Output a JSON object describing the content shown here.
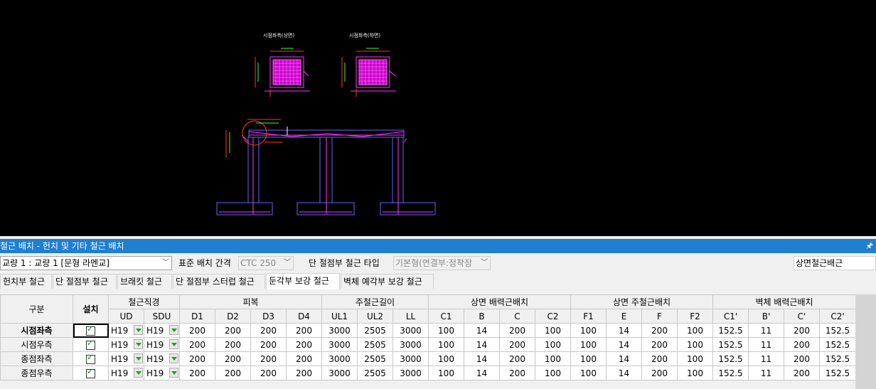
{
  "drawing": {
    "title_left": "시점좌측(상면)",
    "title_right": "시점좌측(하면)"
  },
  "panel": {
    "title": "철근 배치 - 헌치 및 기타 철근 배치",
    "pin_icon": "pin-icon"
  },
  "toolbar": {
    "bridge_select": "교량 1 : 교량 1 [문형 라멘교]",
    "spacing_label": "표준 배치 간격",
    "spacing_value": "CTC 250",
    "end_type_label": "단 절점부 철근 타입",
    "end_type_value": "기본형(연결부:정착장",
    "right_field": "상면철근배근"
  },
  "tabs": [
    {
      "label": "헌치부 철근",
      "active": false
    },
    {
      "label": "단 절점부 철근",
      "active": false
    },
    {
      "label": "브래킷 철근",
      "active": false
    },
    {
      "label": "단 절점부 스터럽 철근",
      "active": false
    },
    {
      "label": "둔각부 보강 철근",
      "active": true
    },
    {
      "label": "벽체 예각부 보강 철근",
      "active": false
    }
  ],
  "table": {
    "group_headers": {
      "gubun": "구분",
      "install": "설치",
      "bar_dia": "철근직경",
      "cover": "피복",
      "main_len": "주철근길이",
      "top_dist": "상면 배력근배치",
      "top_main": "상면 주철근배치",
      "wall_dist": "벽체 배력근배치"
    },
    "columns": [
      "UD",
      "SDU",
      "D1",
      "D2",
      "D3",
      "D4",
      "UL1",
      "UL2",
      "LL",
      "C1",
      "B",
      "C",
      "C2",
      "F1",
      "E",
      "F",
      "F2",
      "C1'",
      "B'",
      "C'",
      "C2'"
    ],
    "rows": [
      {
        "name": "시점좌측",
        "install": true,
        "ud": "H19",
        "sdu": "H19",
        "values": [
          "200",
          "200",
          "200",
          "200",
          "3000",
          "2505",
          "3000",
          "100",
          "14",
          "200",
          "100",
          "100",
          "14",
          "200",
          "100",
          "152.5",
          "11",
          "200",
          "152.5"
        ]
      },
      {
        "name": "시점우측",
        "install": true,
        "ud": "H19",
        "sdu": "H19",
        "values": [
          "200",
          "200",
          "200",
          "200",
          "3000",
          "2505",
          "3000",
          "100",
          "14",
          "200",
          "100",
          "100",
          "14",
          "200",
          "100",
          "152.5",
          "11",
          "200",
          "152.5"
        ]
      },
      {
        "name": "종점좌측",
        "install": true,
        "ud": "H19",
        "sdu": "H19",
        "values": [
          "200",
          "200",
          "200",
          "200",
          "3000",
          "2505",
          "3000",
          "100",
          "14",
          "200",
          "100",
          "100",
          "14",
          "200",
          "100",
          "152.5",
          "11",
          "200",
          "152.5"
        ]
      },
      {
        "name": "종점우측",
        "install": true,
        "ud": "H19",
        "sdu": "H19",
        "values": [
          "200",
          "200",
          "200",
          "200",
          "3000",
          "2505",
          "3000",
          "100",
          "14",
          "200",
          "100",
          "100",
          "14",
          "200",
          "100",
          "152.5",
          "11",
          "200",
          "152.5"
        ]
      }
    ]
  }
}
